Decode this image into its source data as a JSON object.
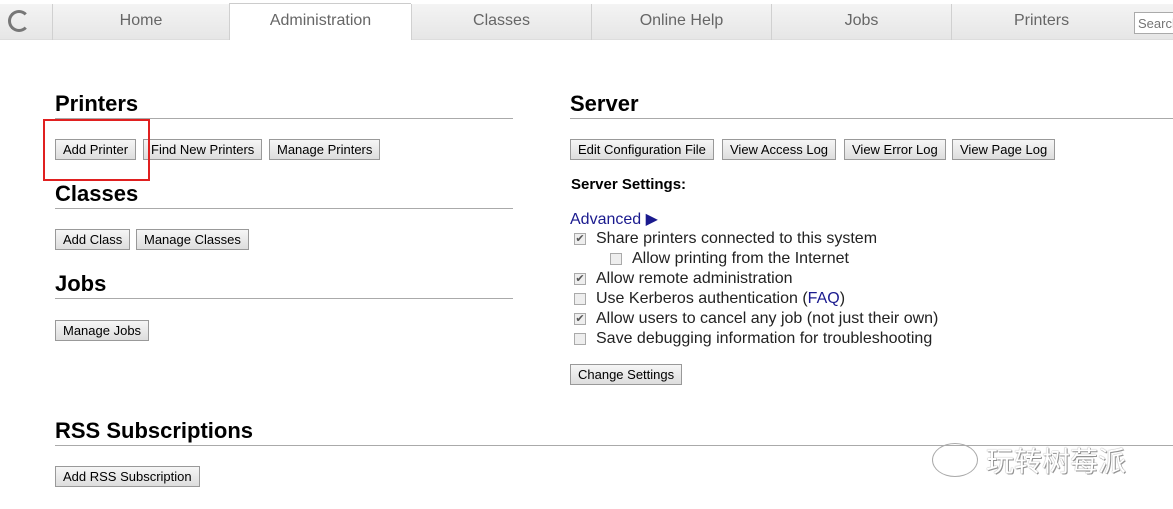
{
  "nav": {
    "tabs": [
      "Home",
      "Administration",
      "Classes",
      "Online Help",
      "Jobs",
      "Printers"
    ],
    "active": "Administration",
    "search_placeholder": "Search"
  },
  "printers": {
    "title": "Printers",
    "buttons": [
      "Add Printer",
      "Find New Printers",
      "Manage Printers"
    ]
  },
  "classes": {
    "title": "Classes",
    "buttons": [
      "Add Class",
      "Manage Classes"
    ]
  },
  "jobs": {
    "title": "Jobs",
    "buttons": [
      "Manage Jobs"
    ]
  },
  "rss": {
    "title": "RSS Subscriptions",
    "buttons": [
      "Add RSS Subscription"
    ]
  },
  "server": {
    "title": "Server",
    "buttons": [
      "Edit Configuration File",
      "View Access Log",
      "View Error Log",
      "View Page Log"
    ],
    "settings_label": "Server Settings:",
    "advanced": "Advanced ▶",
    "options": [
      {
        "label": "Share printers connected to this system",
        "checked": true
      },
      {
        "label": "Allow printing from the Internet",
        "checked": false
      },
      {
        "label": "Allow remote administration",
        "checked": true
      },
      {
        "label": "Use Kerberos authentication (",
        "link": "FAQ",
        "suffix": ")",
        "checked": false
      },
      {
        "label": "Allow users to cancel any job (not just their own)",
        "checked": true
      },
      {
        "label": "Save debugging information for troubleshooting",
        "checked": false
      }
    ],
    "change_settings": "Change Settings"
  },
  "watermark": "玩转树莓派",
  "highlight_color": "#e02020"
}
